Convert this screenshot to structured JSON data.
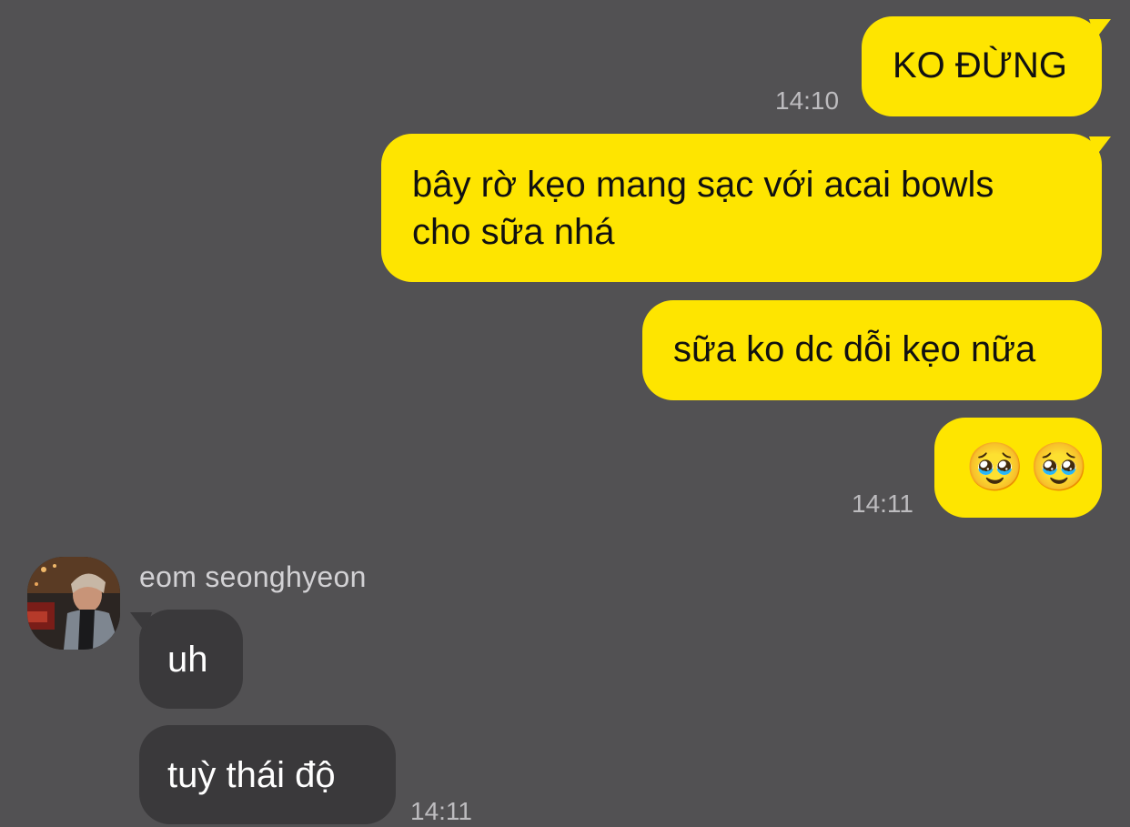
{
  "messages": {
    "out1": {
      "text": "KO ĐỪNG",
      "time": "14:10"
    },
    "out2": {
      "line1": "bây rờ kẹo mang sạc với acai bowls",
      "line2": "cho sữa nhá"
    },
    "out3": {
      "text": "sữa ko dc dỗi kẹo nữa"
    },
    "out4": {
      "emoji1": "🥹",
      "emoji2": "🥹",
      "time": "14:11"
    }
  },
  "incoming": {
    "sender_name": "eom seonghyeon",
    "avatar_icon": "profile-photo",
    "msg1": {
      "text": "uh"
    },
    "msg2": {
      "text": "tuỳ thái độ",
      "time": "14:11"
    }
  },
  "colors": {
    "background": "#525153",
    "outgoing_bubble": "#fee500",
    "incoming_bubble": "#3a393b",
    "timestamp": "#bdbcbf"
  }
}
